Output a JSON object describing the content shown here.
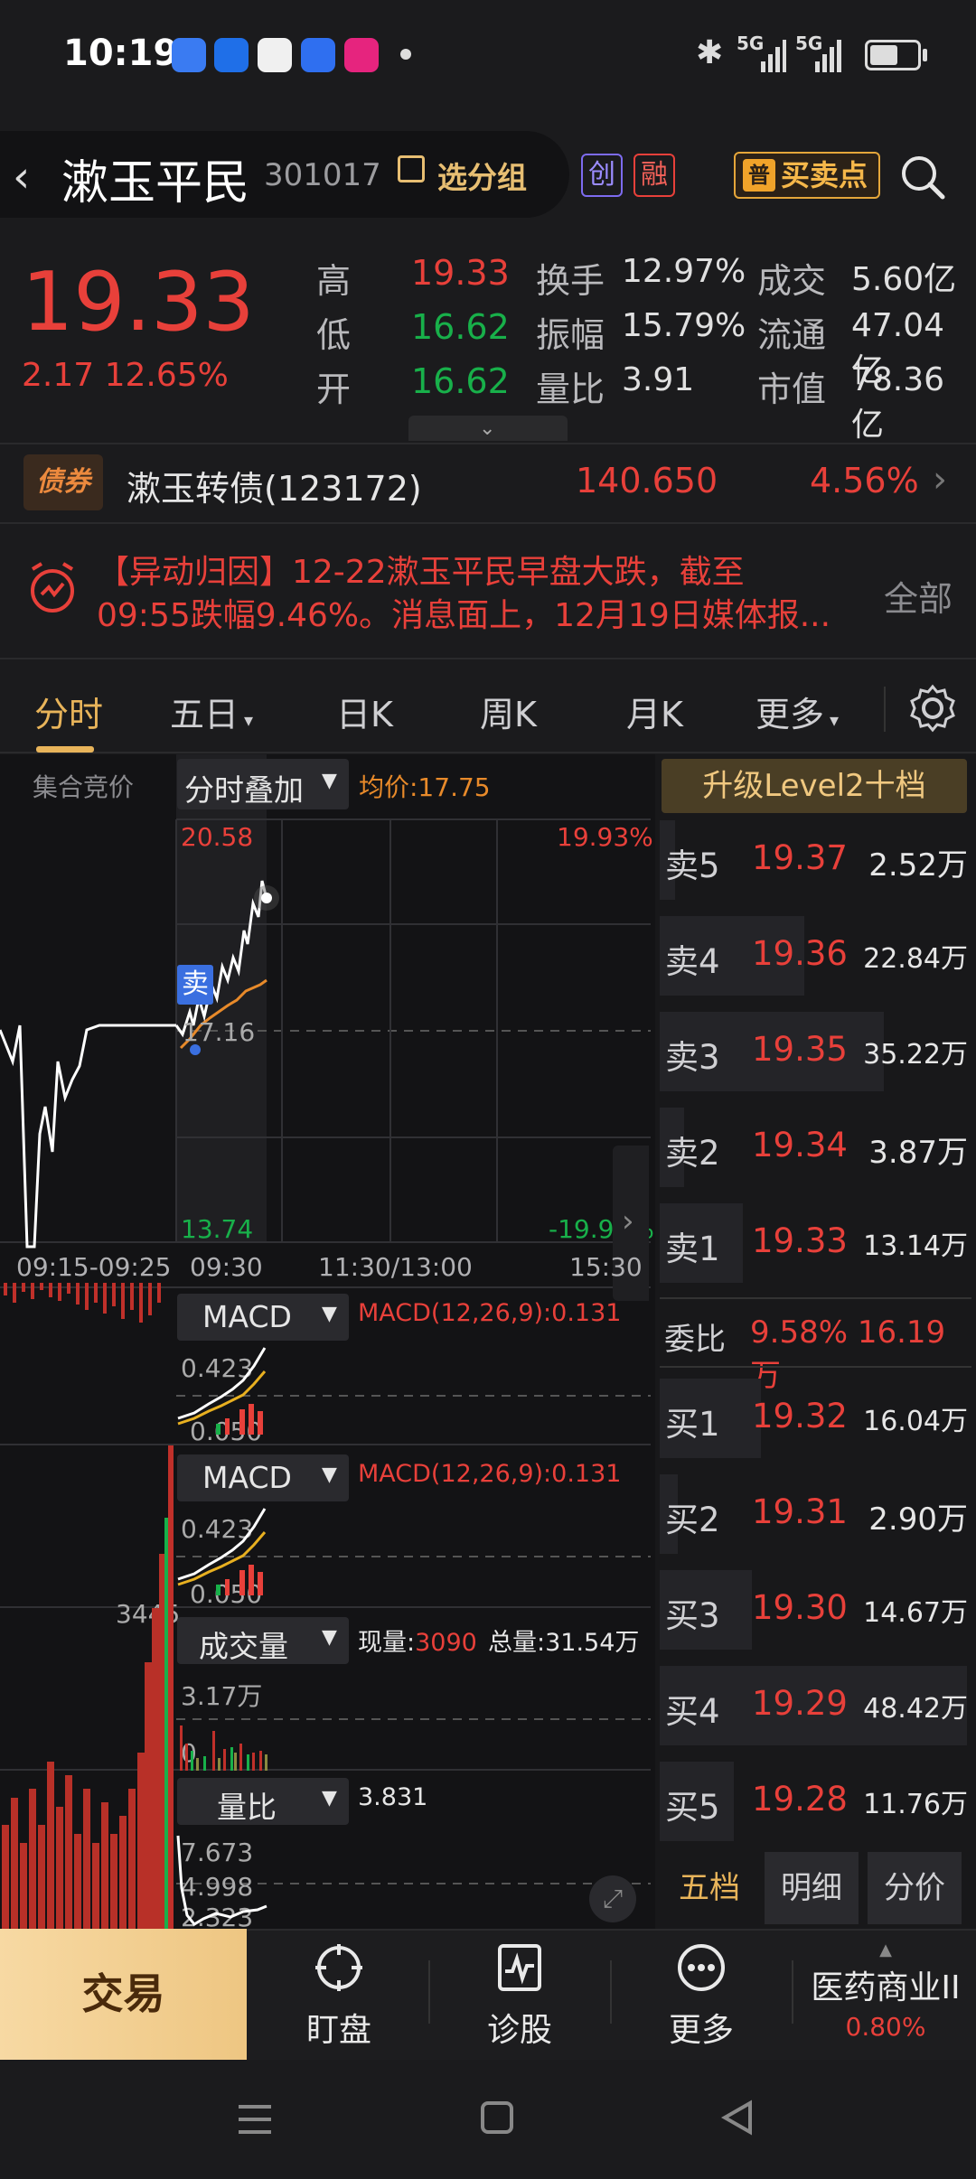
{
  "status_bar": {
    "time": "10:19",
    "net1": "5G",
    "net2": "5G",
    "battery_level": 0.6
  },
  "header": {
    "stock_name": "漱玉平民",
    "stock_code": "301017",
    "group_label": "选分组",
    "badge_chuang": "创",
    "badge_rong": "融",
    "buy_sell_point": "买卖点",
    "back_icon": "chevron-left-icon",
    "search_icon": "search-icon"
  },
  "quote": {
    "price": "19.33",
    "change": "2.17 12.65%",
    "rows": [
      {
        "l1": "高",
        "v1": "19.33",
        "c1": "#e8403a",
        "l2": "换手",
        "v2": "12.97%",
        "l3": "成交",
        "v3": "5.60亿"
      },
      {
        "l1": "低",
        "v1": "16.62",
        "c1": "#18b04a",
        "l2": "振幅",
        "v2": "15.79%",
        "l3": "流通",
        "v3": "47.04亿"
      },
      {
        "l1": "开",
        "v1": "16.62",
        "c1": "#18b04a",
        "l2": "量比",
        "v2": "3.91",
        "l3": "市值",
        "v3": "78.36亿"
      }
    ]
  },
  "bond": {
    "tag": "债券",
    "name": "漱玉转债(123172)",
    "price": "140.650",
    "change": "4.56%"
  },
  "alert": {
    "line1": "【异动归因】12-22漱玉平民早盘大跌，截至",
    "line2": "09:55跌幅9.46%。消息面上，12月19日媒体报...",
    "all_label": "全部"
  },
  "tabs": [
    "分时",
    "五日",
    "日K",
    "周K",
    "月K",
    "更多"
  ],
  "chart": {
    "pre_label": "集合竞价",
    "overlay_label": "分时叠加",
    "avg_price": "均价:17.75",
    "top_price": "20.58",
    "top_pct": "19.93%",
    "mid_price": "17.16",
    "bottom_price": "13.74",
    "bottom_pct": "-19.93%",
    "sell_marker": "卖",
    "time_labels": [
      "09:15-09:25",
      "09:30",
      "11:30/13:00",
      "15:30"
    ],
    "macd_label": "MACD",
    "macd_value": "MACD(12,26,9):0.131",
    "macd_top": "0.423",
    "macd_bottom": "0.050",
    "macd2_top": "0.423",
    "macd2_bottom": "0.050",
    "pre_vol_max": "3445",
    "vol_label": "成交量",
    "vol_now_label": "现量:",
    "vol_now": "3090",
    "vol_total": "总量:31.54万",
    "vol_top": "3.17万",
    "vol_bottom": "0",
    "ratio_label": "量比",
    "ratio_value": "3.831",
    "ratio_ticks": [
      "7.673",
      "4.998",
      "2.323"
    ]
  },
  "order_book": {
    "upgrade": "升级Level2十档",
    "sells": [
      {
        "label": "卖5",
        "price": "19.37",
        "vol": "2.52万",
        "bar": 0.05
      },
      {
        "label": "卖4",
        "price": "19.36",
        "vol": "22.84万",
        "bar": 0.47
      },
      {
        "label": "卖3",
        "price": "19.35",
        "vol": "35.22万",
        "bar": 0.73
      },
      {
        "label": "卖2",
        "price": "19.34",
        "vol": "3.87万",
        "bar": 0.08
      },
      {
        "label": "卖1",
        "price": "19.33",
        "vol": "13.14万",
        "bar": 0.27
      }
    ],
    "weibi_label": "委比",
    "weibi_value": "9.58% 16.19万",
    "buys": [
      {
        "label": "买1",
        "price": "19.32",
        "vol": "16.04万",
        "bar": 0.33
      },
      {
        "label": "买2",
        "price": "19.31",
        "vol": "2.90万",
        "bar": 0.06
      },
      {
        "label": "买3",
        "price": "19.30",
        "vol": "14.67万",
        "bar": 0.3
      },
      {
        "label": "买4",
        "price": "19.29",
        "vol": "48.42万",
        "bar": 1.0
      },
      {
        "label": "买5",
        "price": "19.28",
        "vol": "11.76万",
        "bar": 0.24
      }
    ],
    "bottom_tabs": [
      "五档",
      "明细",
      "分价"
    ]
  },
  "bottom_nav": {
    "trade": "交易",
    "items": [
      "盯盘",
      "诊股",
      "更多"
    ],
    "sector_name": "医药商业II",
    "sector_change": "0.80%"
  }
}
